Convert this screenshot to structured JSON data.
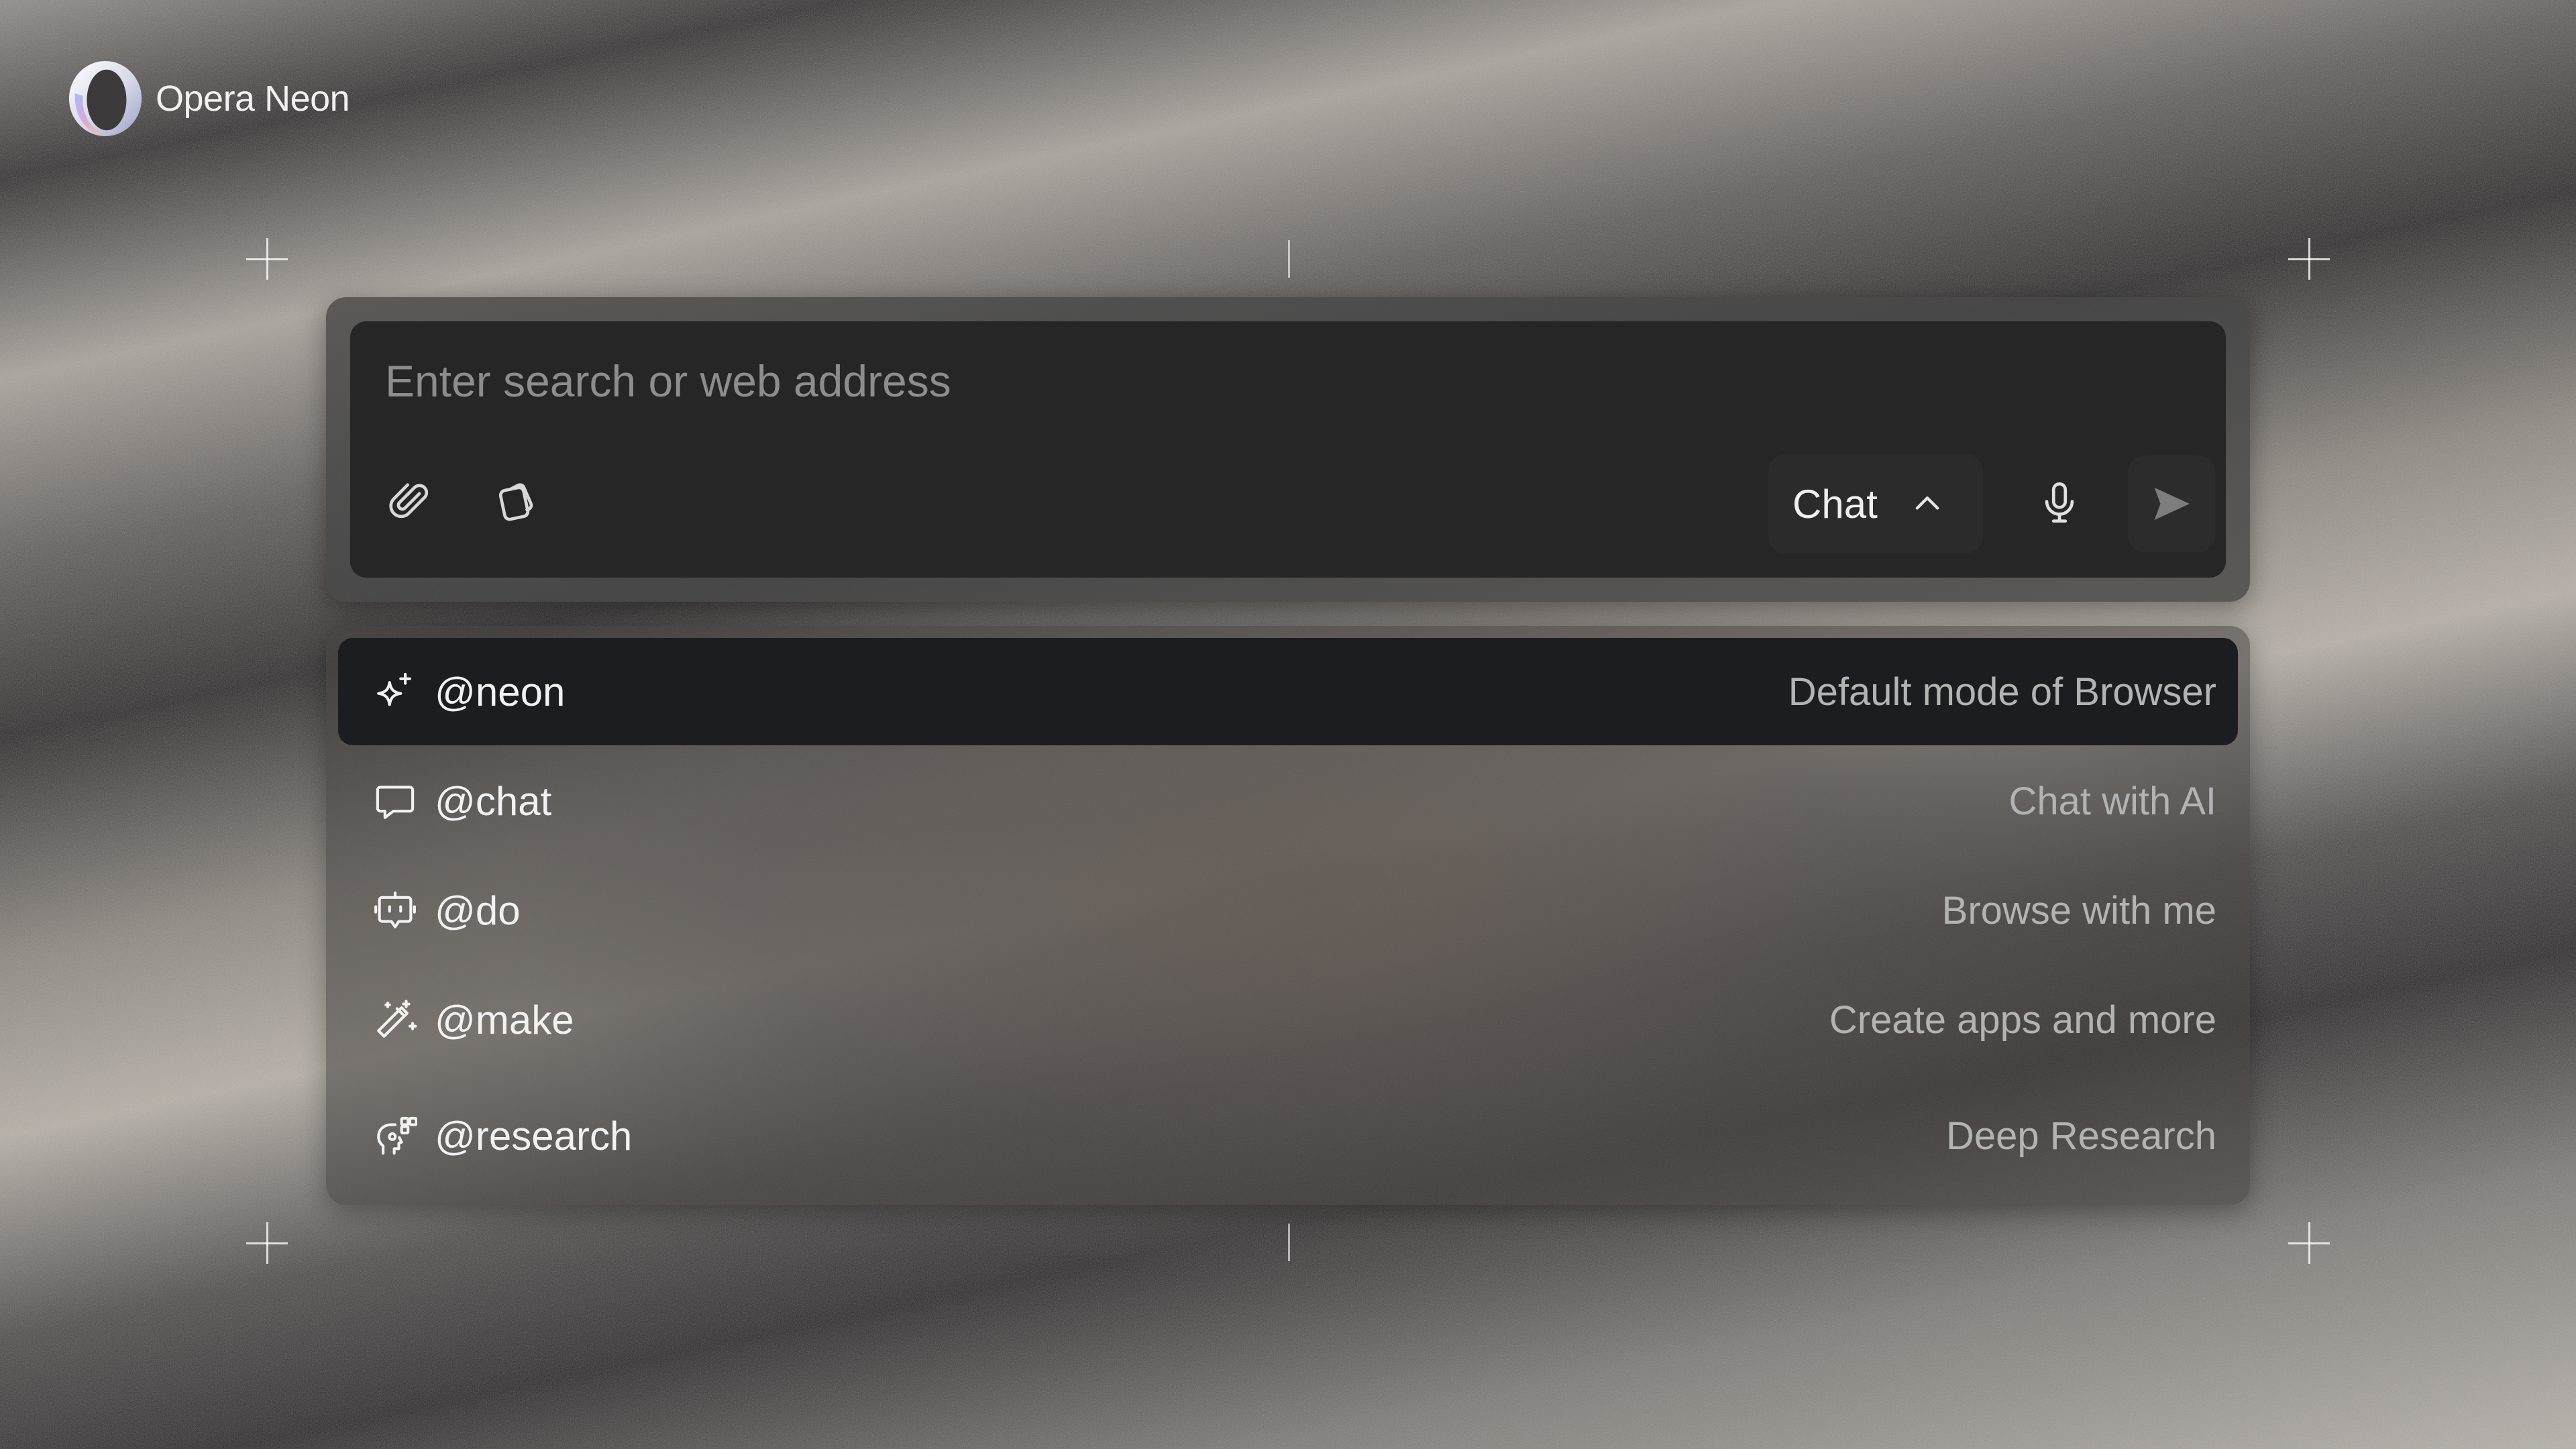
{
  "app": {
    "brand_name": "Opera Neon"
  },
  "search": {
    "placeholder": "Enter search or web address",
    "value": "",
    "mode_label": "Chat",
    "icons": [
      "paperclip-icon",
      "tabs-icon",
      "chevron-up-icon",
      "microphone-icon",
      "send-icon"
    ]
  },
  "commands": [
    {
      "name": "@neon",
      "description": "Default mode of Browser",
      "icon": "sparkle-icon",
      "active": true
    },
    {
      "name": "@chat",
      "description": "Chat with AI",
      "icon": "chat-bubble-icon",
      "active": false
    },
    {
      "name": "@do",
      "description": "Browse with me",
      "icon": "agent-bot-icon",
      "active": false
    },
    {
      "name": "@make",
      "description": "Create apps and more",
      "icon": "magic-wand-icon",
      "active": false
    },
    {
      "name": "@research",
      "description": "Deep Research",
      "icon": "research-icon",
      "active": false
    }
  ],
  "colors": {
    "panel": "#262626",
    "active_row": "#1b1d20",
    "text_primary": "#f2f2f2",
    "text_secondary": "#b3b3b3",
    "placeholder": "#8d8d8d"
  }
}
